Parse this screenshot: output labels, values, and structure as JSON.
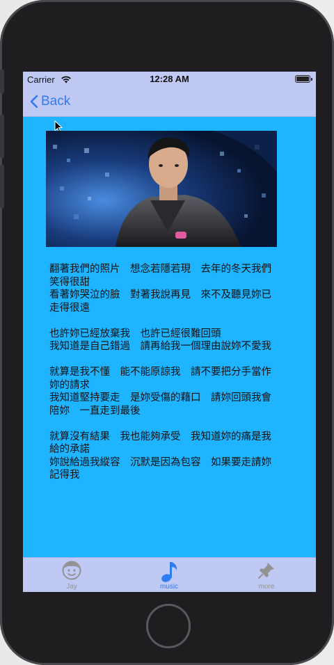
{
  "status_bar": {
    "carrier": "Carrier",
    "time": "12:28 AM"
  },
  "nav": {
    "back_label": "Back"
  },
  "photo": {
    "description_icon": "artist-photo"
  },
  "lyrics": {
    "text": "翻著我們的照片　想念若隱若現　去年的冬天我們笑得很甜\n看著妳哭泣的臉　對著我說再見　來不及聽見妳已走得很遠\n\n也許妳已經放棄我　也許已經很難回頭\n我知道是自己錯過　請再給我一個理由說妳不愛我\n\n就算是我不懂　能不能原諒我　請不要把分手當作妳的請求\n我知道堅持要走　是妳受傷的藉口　請妳回頭我會陪妳　一直走到最後\n\n就算沒有結果　我也能夠承受　我知道妳的痛是我給的承諾\n妳說給過我縱容　沉默是因為包容　如果要走請妳記得我"
  },
  "tabs": [
    {
      "label": "Jay",
      "icon": "smiley-face-icon",
      "active": false
    },
    {
      "label": "music",
      "icon": "music-note-icon",
      "active": true
    },
    {
      "label": "more",
      "icon": "pushpin-icon",
      "active": false
    }
  ],
  "colors": {
    "screen_bg": "#1eb4ff",
    "bar_bg": "#c0c8f4",
    "accent": "#2e7bf6",
    "inactive": "#929292"
  }
}
